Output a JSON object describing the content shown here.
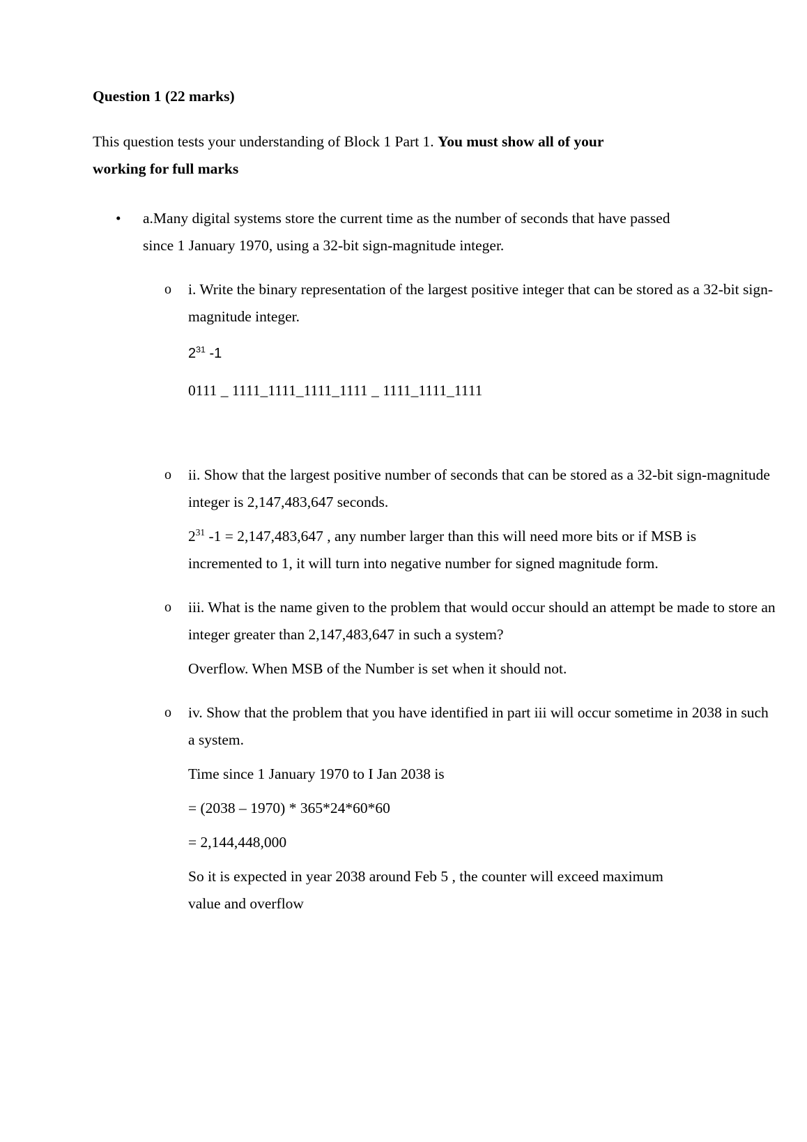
{
  "document": {
    "heading": "Question 1 (22 marks)",
    "intro": {
      "normal": "This question tests your understanding of Block 1 Part 1. ",
      "bold": "You must show all of your working for full marks"
    },
    "bullet_marker": "•",
    "sub_marker": "o",
    "part_a": {
      "text": "a.Many digital systems store the current time as the number of seconds that have passed since 1 January 1970, using a 32-bit sign-magnitude integer."
    },
    "items": [
      {
        "label": "i.",
        "question": "i. Write the binary representation of the largest positive integer that can be stored as a 32-bit sign-magnitude integer.",
        "answers": [
          {
            "style": "sans-superscript",
            "base": "2",
            "exponent": "31",
            "suffix": " -1"
          },
          {
            "style": "plain",
            "text": "0111 _ 1111_1111_1111_1111 _ 1111_1111_1111"
          }
        ]
      },
      {
        "label": "ii.",
        "question": "ii. Show that the largest positive number of seconds that can be stored as a 32-bit sign-magnitude integer is 2,147,483,647 seconds.",
        "answers": [
          {
            "style": "serif-superscript",
            "base": "2",
            "exponent": "31",
            "suffix": " -1 = 2,147,483,647 , any number larger than this will need more bits or if MSB is incremented to 1, it will turn into negative number for signed magnitude form."
          }
        ]
      },
      {
        "label": "iii.",
        "question": "iii. What is the name given to the problem that would occur should an attempt be made to store an integer greater than 2,147,483,647 in such a system?",
        "answers": [
          {
            "style": "plain",
            "text": "Overflow. When MSB of the Number is set when it should not."
          }
        ]
      },
      {
        "label": "iv.",
        "question": "iv. Show that the problem that you have identified in part iii will occur sometime in 2038 in such a system.",
        "answers": [
          {
            "style": "plain",
            "text": "Time since 1 January 1970 to I Jan 2038 is"
          },
          {
            "style": "plain",
            "text": "= (2038 – 1970) * 365*24*60*60"
          },
          {
            "style": "plain",
            "text": "= 2,144,448,000"
          },
          {
            "style": "plain",
            "text": "So it is expected in year 2038 around Feb 5 , the counter will exceed maximum value and overflow"
          }
        ]
      }
    ]
  }
}
